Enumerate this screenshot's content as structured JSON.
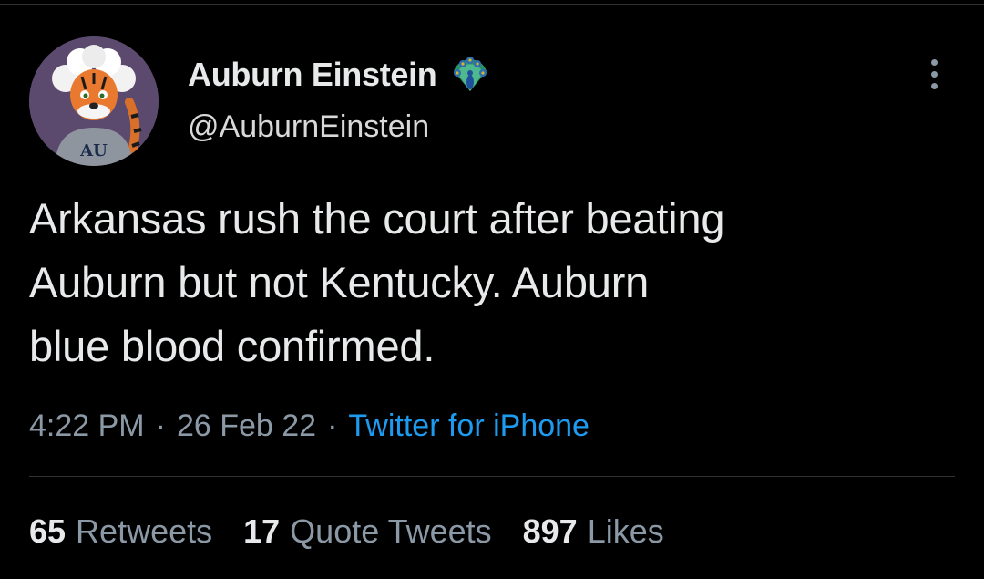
{
  "tweet": {
    "display_name": "Auburn Einstein",
    "handle": "@AuburnEinstein",
    "text_lines": [
      "Arkansas rush the court after beating",
      "Auburn but not Kentucky. Auburn",
      "blue blood confirmed."
    ],
    "time": "4:22 PM",
    "date": "26 Feb 22",
    "separator": "·",
    "source": "Twitter for iPhone",
    "stats": {
      "retweets_count": "65",
      "retweets_label": "Retweets",
      "quotes_count": "17",
      "quotes_label": "Quote Tweets",
      "likes_count": "897",
      "likes_label": "Likes"
    },
    "icons": {
      "avatar": "tiger-mascot-einstein-avatar",
      "badge": "peacock-emoji-icon",
      "more": "more-options-icon"
    },
    "colors": {
      "background": "#000000",
      "primary_text": "#e7e9ea",
      "secondary_text": "#8b98a5",
      "link": "#1d9bf0",
      "divider": "#2f3336"
    }
  }
}
